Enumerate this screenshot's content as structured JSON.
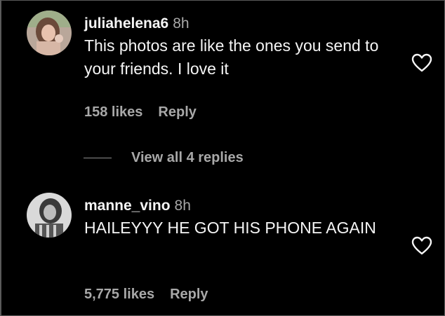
{
  "comments": [
    {
      "username": "juliahelena6",
      "time": "8h",
      "text": "This photos are like the ones you send to your friends. I love it",
      "likes": "158 likes",
      "reply": "Reply",
      "avatar_icon": "profile-photo-avatar",
      "like_icon": "heart-outline-icon"
    },
    {
      "username": "manne_vino",
      "time": "8h",
      "text": "HAILEYYY HE GOT HIS PHONE AGAIN",
      "likes": "5,775 likes",
      "reply": "Reply",
      "avatar_icon": "profile-photo-avatar",
      "like_icon": "heart-outline-icon"
    }
  ],
  "view_replies": "View all 4 replies",
  "colors": {
    "background": "#000000",
    "text_primary": "#f5f5f5",
    "text_secondary": "#a8a8a8"
  }
}
